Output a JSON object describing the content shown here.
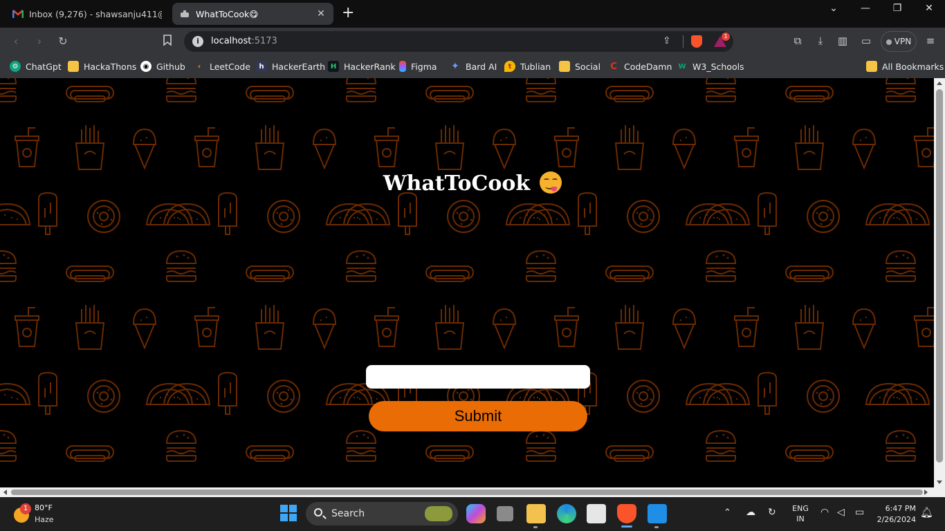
{
  "browser": {
    "tabs": [
      {
        "title": "Inbox (9,276) - shawsanju411@gmail",
        "icon": "gmail-icon",
        "active": false
      },
      {
        "title": "WhatToCook😋",
        "icon": "pot-icon",
        "active": true
      }
    ],
    "address": {
      "host": "localhost",
      "port": ":5173"
    },
    "shields_badge": "1",
    "vpn_label": "VPN",
    "bookmarks": [
      {
        "label": "ChatGpt",
        "icon": "chatgpt-icon"
      },
      {
        "label": "HackaThons",
        "icon": "folder-icon"
      },
      {
        "label": "Github",
        "icon": "github-icon"
      },
      {
        "label": "LeetCode",
        "icon": "leetcode-icon"
      },
      {
        "label": "HackerEarth",
        "icon": "hackerearth-icon"
      },
      {
        "label": "HackerRank",
        "icon": "hackerrank-icon"
      },
      {
        "label": "Figma",
        "icon": "figma-icon"
      },
      {
        "label": "Bard AI",
        "icon": "bard-icon"
      },
      {
        "label": "Tublian",
        "icon": "tublian-icon"
      },
      {
        "label": "Social",
        "icon": "folder-icon"
      },
      {
        "label": "CodeDamn",
        "icon": "codedamn-icon"
      },
      {
        "label": "W3_Schools",
        "icon": "w3schools-icon"
      }
    ],
    "all_bookmarks": "All Bookmarks"
  },
  "page": {
    "title": "WhatToCook",
    "emoji": "face-savoring-food-emoji",
    "input_value": "",
    "submit_label": "Submit",
    "pattern_color": "#6b2a00",
    "accent_color": "#ea6c04"
  },
  "taskbar": {
    "weather_badge": "1",
    "temperature": "80°F",
    "condition": "Haze",
    "search_label": "Search",
    "language": "ENG",
    "region": "IN",
    "time": "6:47 PM",
    "date": "2/26/2024"
  }
}
